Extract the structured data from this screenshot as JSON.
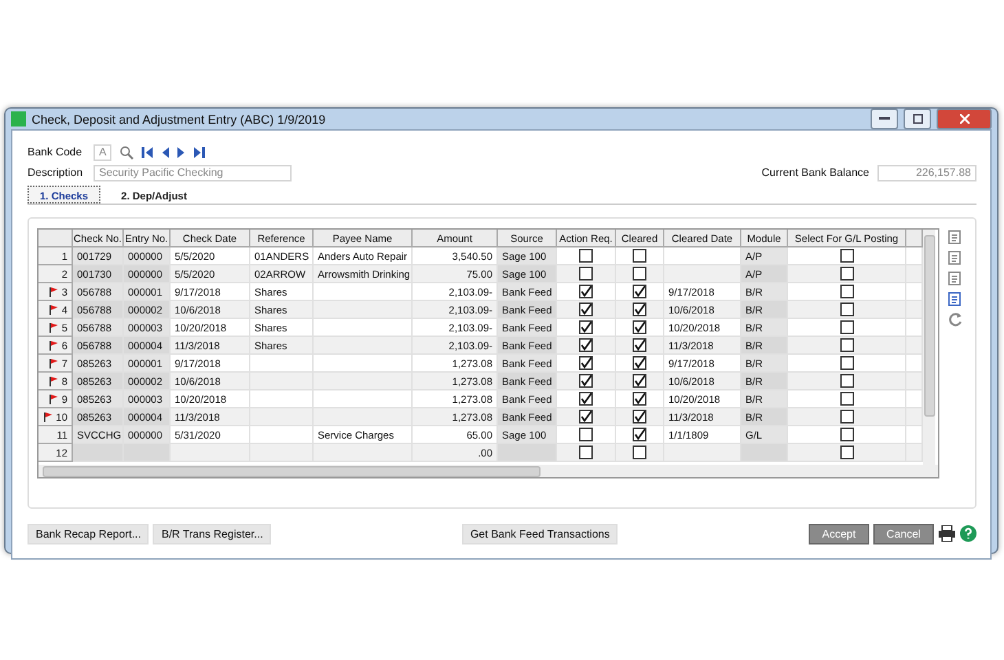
{
  "window": {
    "title": "Check, Deposit and Adjustment Entry (ABC) 1/9/2019"
  },
  "bank_code": {
    "label": "Bank Code",
    "value": "A"
  },
  "description": {
    "label": "Description",
    "value": "Security Pacific Checking"
  },
  "current_bank_balance": {
    "label": "Current Bank Balance",
    "value": "226,157.88"
  },
  "tabs": [
    {
      "label": "1. Checks",
      "selected": true
    },
    {
      "label": "2. Dep/Adjust",
      "selected": false
    }
  ],
  "grid": {
    "columns": [
      "Check No.",
      "Entry No.",
      "Check Date",
      "Reference",
      "Payee Name",
      "Amount",
      "Source",
      "Action Req.",
      "Cleared",
      "Cleared Date",
      "Module",
      "Select For G/L Posting"
    ],
    "rows": [
      {
        "number": "1",
        "flagged": false,
        "check_no": "001729",
        "entry_no": "000000",
        "check_date": "5/5/2020",
        "reference": "01ANDERS",
        "payee": "Anders Auto Repair",
        "amount": "3,540.50",
        "source": "Sage 100",
        "action_req": false,
        "cleared": false,
        "cleared_date": "",
        "module": "A/P",
        "select_gl": false
      },
      {
        "number": "2",
        "flagged": false,
        "check_no": "001730",
        "entry_no": "000000",
        "check_date": "5/5/2020",
        "reference": "02ARROW",
        "payee": "Arrowsmith Drinking",
        "amount": "75.00",
        "source": "Sage 100",
        "action_req": false,
        "cleared": false,
        "cleared_date": "",
        "module": "A/P",
        "select_gl": false
      },
      {
        "number": "3",
        "flagged": true,
        "check_no": "056788",
        "entry_no": "000001",
        "check_date": "9/17/2018",
        "reference": "Shares",
        "payee": "",
        "amount": "2,103.09-",
        "source": "Bank Feed",
        "action_req": true,
        "cleared": true,
        "cleared_date": "9/17/2018",
        "module": "B/R",
        "select_gl": false
      },
      {
        "number": "4",
        "flagged": true,
        "check_no": "056788",
        "entry_no": "000002",
        "check_date": "10/6/2018",
        "reference": "Shares",
        "payee": "",
        "amount": "2,103.09-",
        "source": "Bank Feed",
        "action_req": true,
        "cleared": true,
        "cleared_date": "10/6/2018",
        "module": "B/R",
        "select_gl": false
      },
      {
        "number": "5",
        "flagged": true,
        "check_no": "056788",
        "entry_no": "000003",
        "check_date": "10/20/2018",
        "reference": "Shares",
        "payee": "",
        "amount": "2,103.09-",
        "source": "Bank Feed",
        "action_req": true,
        "cleared": true,
        "cleared_date": "10/20/2018",
        "module": "B/R",
        "select_gl": false
      },
      {
        "number": "6",
        "flagged": true,
        "check_no": "056788",
        "entry_no": "000004",
        "check_date": "11/3/2018",
        "reference": "Shares",
        "payee": "",
        "amount": "2,103.09-",
        "source": "Bank Feed",
        "action_req": true,
        "cleared": true,
        "cleared_date": "11/3/2018",
        "module": "B/R",
        "select_gl": false
      },
      {
        "number": "7",
        "flagged": true,
        "check_no": "085263",
        "entry_no": "000001",
        "check_date": "9/17/2018",
        "reference": "",
        "payee": "",
        "amount": "1,273.08",
        "source": "Bank Feed",
        "action_req": true,
        "cleared": true,
        "cleared_date": "9/17/2018",
        "module": "B/R",
        "select_gl": false
      },
      {
        "number": "8",
        "flagged": true,
        "check_no": "085263",
        "entry_no": "000002",
        "check_date": "10/6/2018",
        "reference": "",
        "payee": "",
        "amount": "1,273.08",
        "source": "Bank Feed",
        "action_req": true,
        "cleared": true,
        "cleared_date": "10/6/2018",
        "module": "B/R",
        "select_gl": false
      },
      {
        "number": "9",
        "flagged": true,
        "check_no": "085263",
        "entry_no": "000003",
        "check_date": "10/20/2018",
        "reference": "",
        "payee": "",
        "amount": "1,273.08",
        "source": "Bank Feed",
        "action_req": true,
        "cleared": true,
        "cleared_date": "10/20/2018",
        "module": "B/R",
        "select_gl": false
      },
      {
        "number": "10",
        "flagged": true,
        "check_no": "085263",
        "entry_no": "000004",
        "check_date": "11/3/2018",
        "reference": "",
        "payee": "",
        "amount": "1,273.08",
        "source": "Bank Feed",
        "action_req": true,
        "cleared": true,
        "cleared_date": "11/3/2018",
        "module": "B/R",
        "select_gl": false
      },
      {
        "number": "11",
        "flagged": false,
        "check_no": "SVCCHG",
        "entry_no": "000000",
        "check_date": "5/31/2020",
        "reference": "",
        "payee": "Service Charges",
        "amount": "65.00",
        "source": "Sage 100",
        "action_req": false,
        "cleared": true,
        "cleared_date": "1/1/1809",
        "module": "G/L",
        "select_gl": false
      },
      {
        "number": "12",
        "flagged": false,
        "check_no": "",
        "entry_no": "",
        "check_date": "",
        "reference": "",
        "payee": "",
        "amount": ".00",
        "source": "",
        "action_req": false,
        "cleared": false,
        "cleared_date": "",
        "module": "",
        "select_gl": false
      }
    ]
  },
  "buttons_left": [
    "Bank Recap Report...",
    "B/R Trans Register..."
  ],
  "button_center": "Get Bank Feed Transactions",
  "buttons_right": [
    "Accept",
    "Cancel"
  ]
}
